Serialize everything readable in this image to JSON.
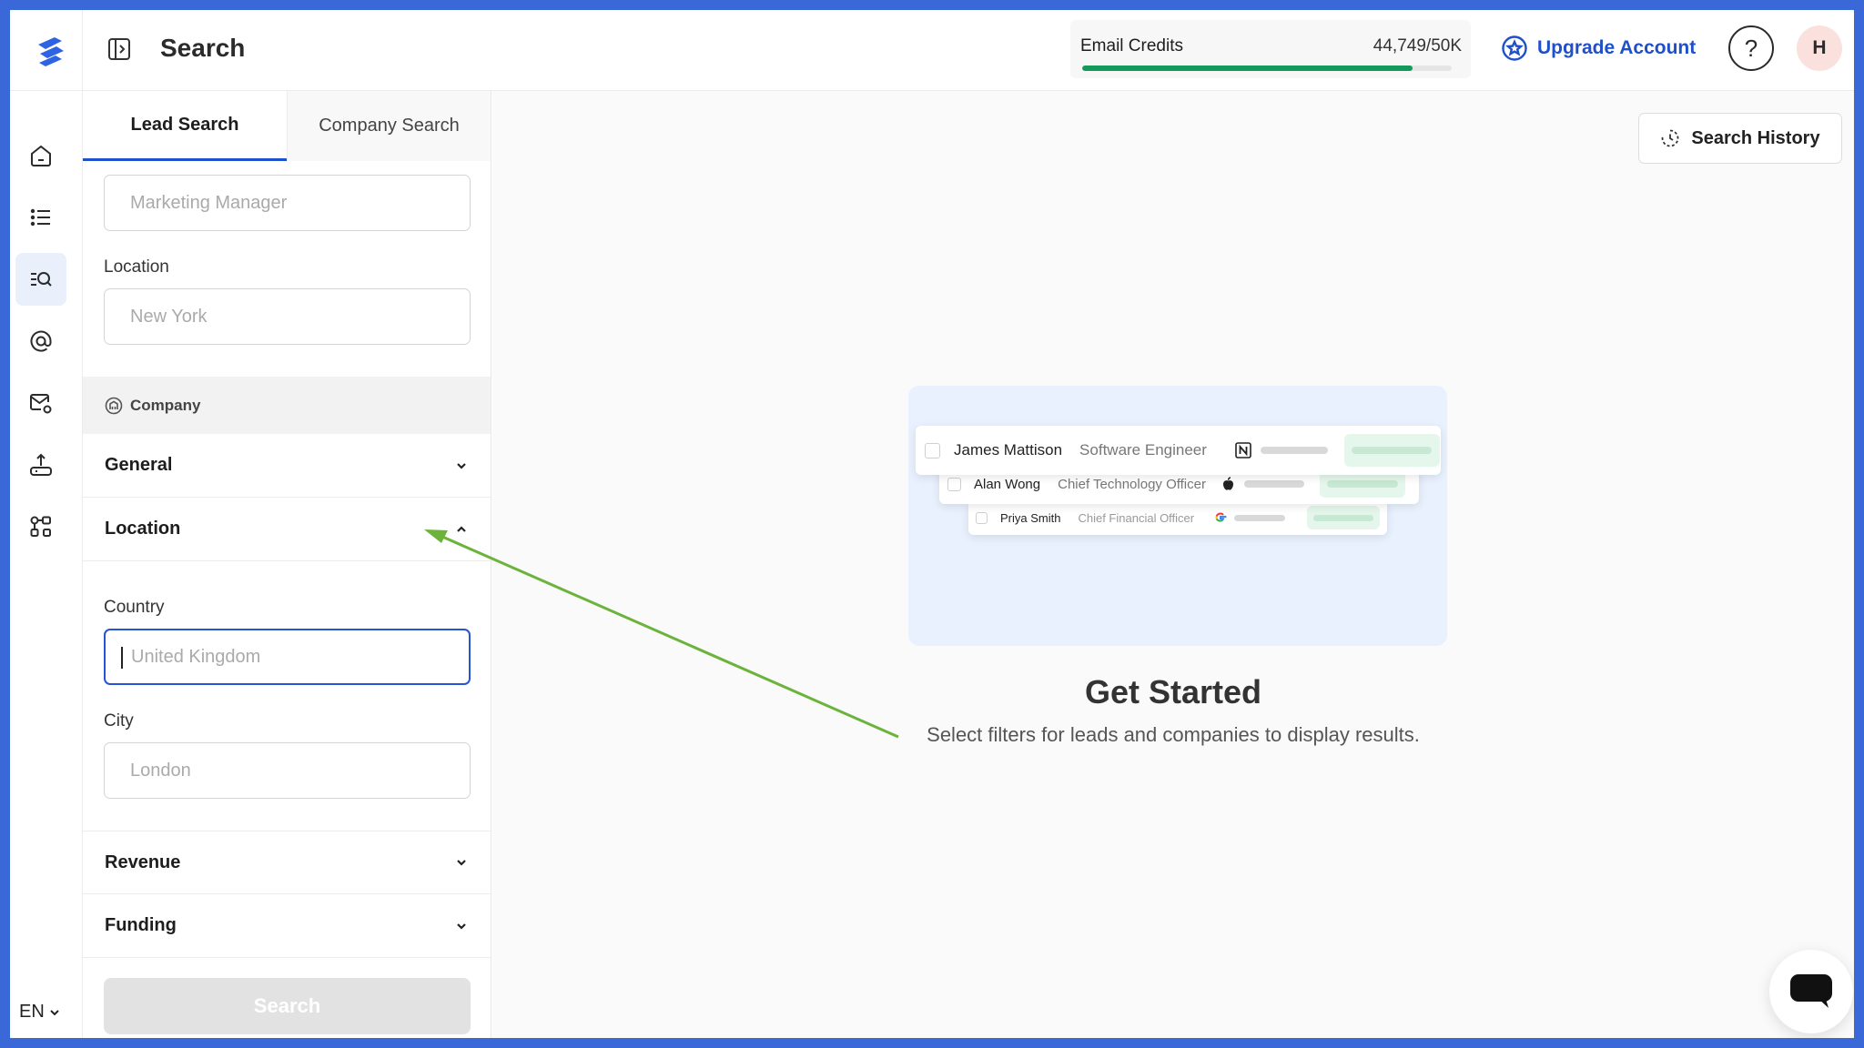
{
  "header": {
    "page_title": "Search",
    "credits": {
      "label": "Email Credits",
      "value": "44,749/50K",
      "fraction": 0.895,
      "bar_color": "#13995a"
    },
    "upgrade_label": "Upgrade Account",
    "help_symbol": "?",
    "avatar_initial": "H"
  },
  "rail": {
    "items": [
      {
        "icon": "home-icon"
      },
      {
        "icon": "list-icon"
      },
      {
        "icon": "search-list-icon",
        "active": true
      },
      {
        "icon": "at-sign-icon"
      },
      {
        "icon": "mail-settings-icon"
      },
      {
        "icon": "upload-icon"
      },
      {
        "icon": "integrations-icon"
      }
    ],
    "language": "EN"
  },
  "tabs": {
    "lead": "Lead Search",
    "company": "Company Search"
  },
  "lead_filters": {
    "job_title_placeholder": "Marketing Manager",
    "location_label": "Location",
    "location_placeholder": "New York"
  },
  "company": {
    "section_label": "Company",
    "general": "General",
    "location": "Location",
    "country_label": "Country",
    "country_placeholder": "United Kingdom",
    "city_label": "City",
    "city_placeholder": "London",
    "revenue": "Revenue",
    "funding": "Funding"
  },
  "search_button": "Search",
  "main": {
    "history_label": "Search History",
    "preview_rows": [
      {
        "name": "James Mattison",
        "title": "Software Engineer",
        "logo": "notion-logo-icon"
      },
      {
        "name": "Alan Wong",
        "title": "Chief Technology Officer",
        "logo": "apple-logo-icon"
      },
      {
        "name": "Priya Smith",
        "title": "Chief Financial Officer",
        "logo": "google-logo-icon"
      }
    ],
    "get_started_title": "Get Started",
    "get_started_subtitle": "Select filters for leads and companies to display results."
  },
  "colors": {
    "accent": "#1f4fc9",
    "frame": "#3B68D9",
    "annotation_arrow": "#6bb33a"
  }
}
